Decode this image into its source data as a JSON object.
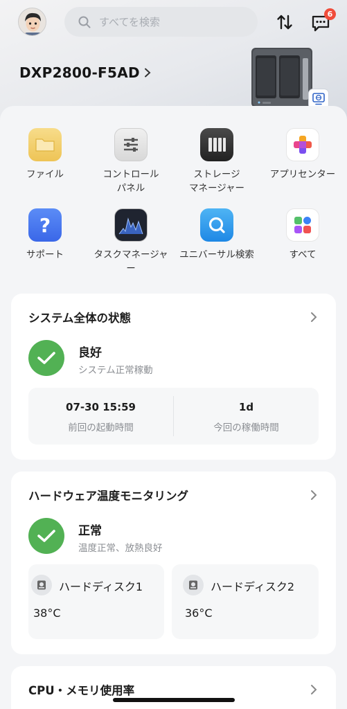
{
  "header": {
    "search_placeholder": "すべてを検索",
    "badge_count": "6",
    "device_name": "DXP2800-F5AD"
  },
  "apps": [
    {
      "label": "ファイル",
      "icon": "folder-icon"
    },
    {
      "label": "コントロール\nパネル",
      "icon": "control-panel-icon"
    },
    {
      "label": "ストレージ\nマネージャー",
      "icon": "storage-manager-icon"
    },
    {
      "label": "アプリセンター",
      "icon": "app-center-icon"
    },
    {
      "label": "サポート",
      "icon": "help-icon"
    },
    {
      "label": "タスクマネージャ\nー",
      "icon": "task-manager-icon"
    },
    {
      "label": "ユニバーサル検索",
      "icon": "universal-search-icon"
    },
    {
      "label": "すべて",
      "icon": "all-apps-icon"
    }
  ],
  "system_status": {
    "title": "システム全体の状態",
    "status": "良好",
    "detail": "システム正常稼動",
    "last_boot_value": "07-30 15:59",
    "last_boot_label": "前回の起動時間",
    "uptime_value": "1d",
    "uptime_label": "今回の稼働時間"
  },
  "hardware_temp": {
    "title": "ハードウェア温度モニタリング",
    "status": "正常",
    "detail": "温度正常、放熱良好",
    "disks": [
      {
        "name": "ハードディスク1",
        "temp": "38°C"
      },
      {
        "name": "ハードディスク2",
        "temp": "36°C"
      }
    ]
  },
  "cpu_memory": {
    "title": "CPU・メモリ使用率"
  },
  "colors": {
    "ok_green": "#52b154",
    "badge_red": "#f04c3a"
  }
}
